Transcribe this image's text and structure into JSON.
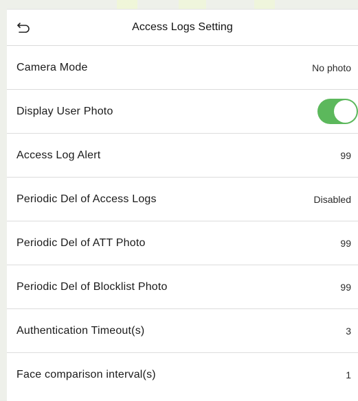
{
  "header": {
    "title": "Access Logs Setting",
    "back_icon": "back-arrow-icon"
  },
  "settings": [
    {
      "label": "Camera Mode",
      "value": "No photo"
    },
    {
      "label": "Display User Photo",
      "toggle_on": true,
      "toggle_color": "#5cb85c"
    },
    {
      "label": "Access Log Alert",
      "value": "99"
    },
    {
      "label": "Periodic Del of Access Logs",
      "value": "Disabled"
    },
    {
      "label": "Periodic Del of ATT Photo",
      "value": "99"
    },
    {
      "label": "Periodic Del of Blocklist Photo",
      "value": "99"
    },
    {
      "label": "Authentication Timeout(s)",
      "value": "3"
    },
    {
      "label": "Face comparison interval(s)",
      "value": "1"
    }
  ]
}
